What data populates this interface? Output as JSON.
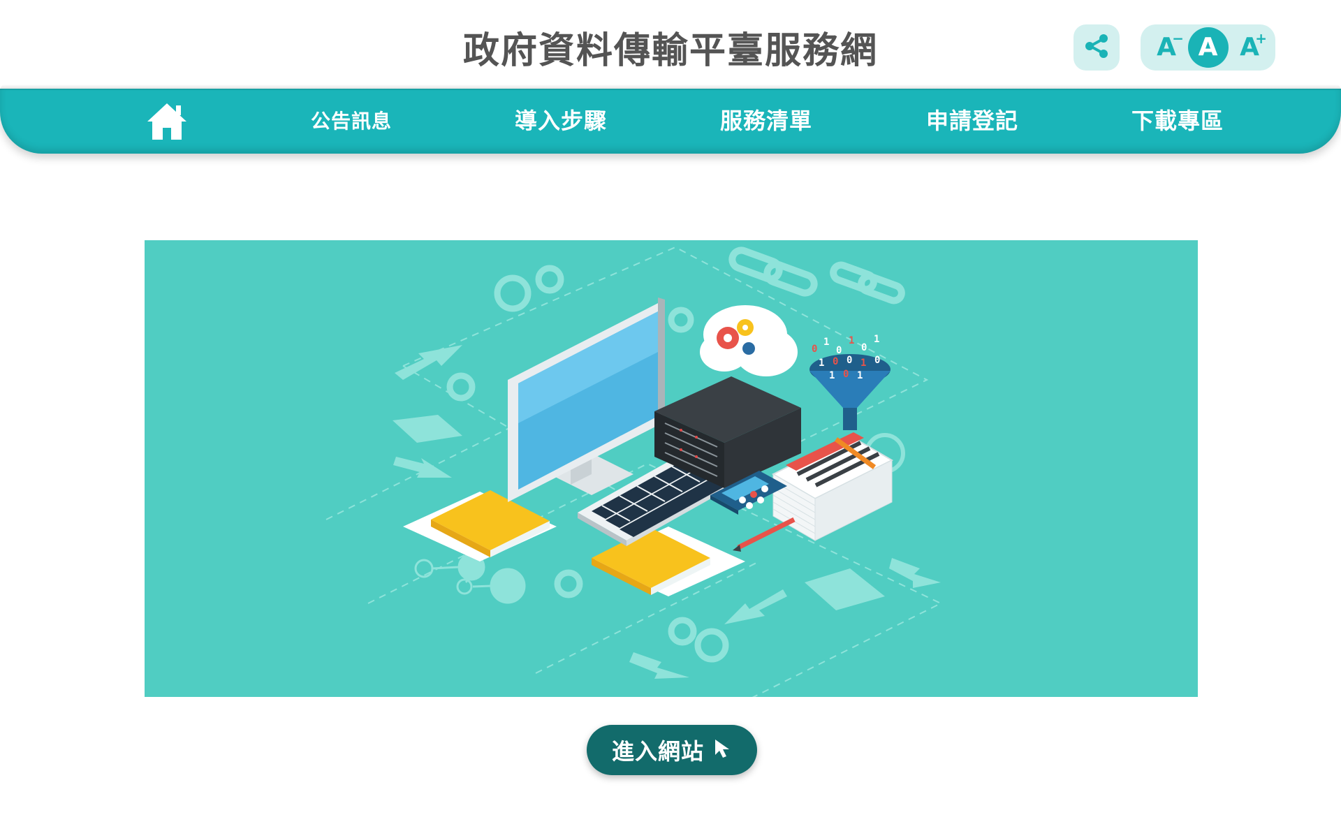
{
  "header": {
    "title": "政府資料傳輸平臺服務網",
    "share_icon": "share-icon",
    "font_sizes": [
      {
        "letter": "A",
        "modifier": "−",
        "icon": "font-decrease-icon"
      },
      {
        "letter": "A",
        "modifier": "",
        "icon": "font-default-icon",
        "active": true
      },
      {
        "letter": "A",
        "modifier": "+",
        "icon": "font-increase-icon"
      }
    ]
  },
  "nav": {
    "home_icon": "home-icon",
    "items": [
      {
        "label": "公告訊息"
      },
      {
        "label": "導入步驟"
      },
      {
        "label": "服務清單"
      },
      {
        "label": "申請登記"
      },
      {
        "label": "下載專區"
      }
    ]
  },
  "hero": {
    "illustration": "isometric-computer-data-illustration"
  },
  "enter": {
    "label": "進入網站",
    "icon": "cursor-arrow-icon"
  },
  "colors": {
    "teal": "#1ab5b9",
    "hero_bg": "#50cdc2",
    "button": "#126b6b",
    "title": "#545454"
  }
}
